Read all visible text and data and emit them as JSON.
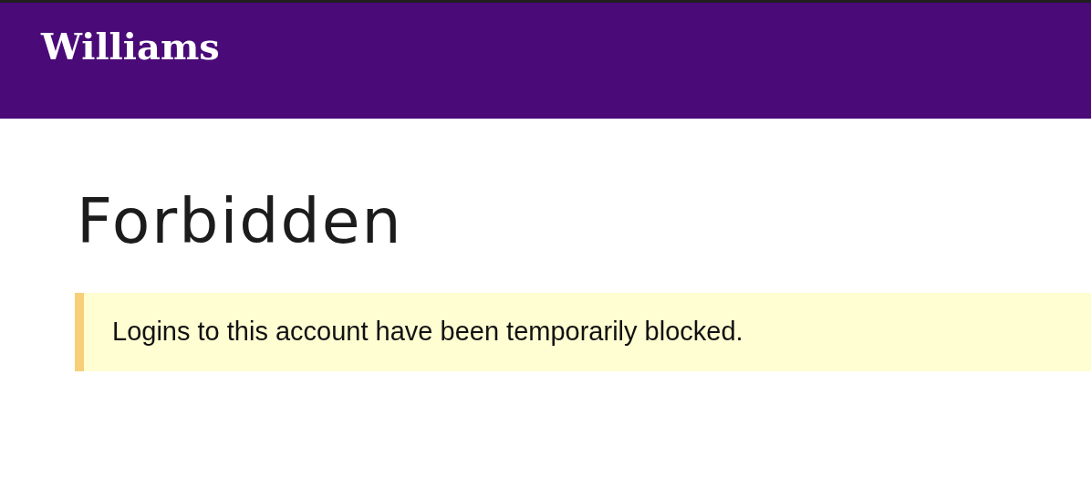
{
  "header": {
    "logo": "Williams"
  },
  "page": {
    "title": "Forbidden"
  },
  "alert": {
    "kind": "warning",
    "message": "Logins to this account have been temporarily blocked."
  }
}
